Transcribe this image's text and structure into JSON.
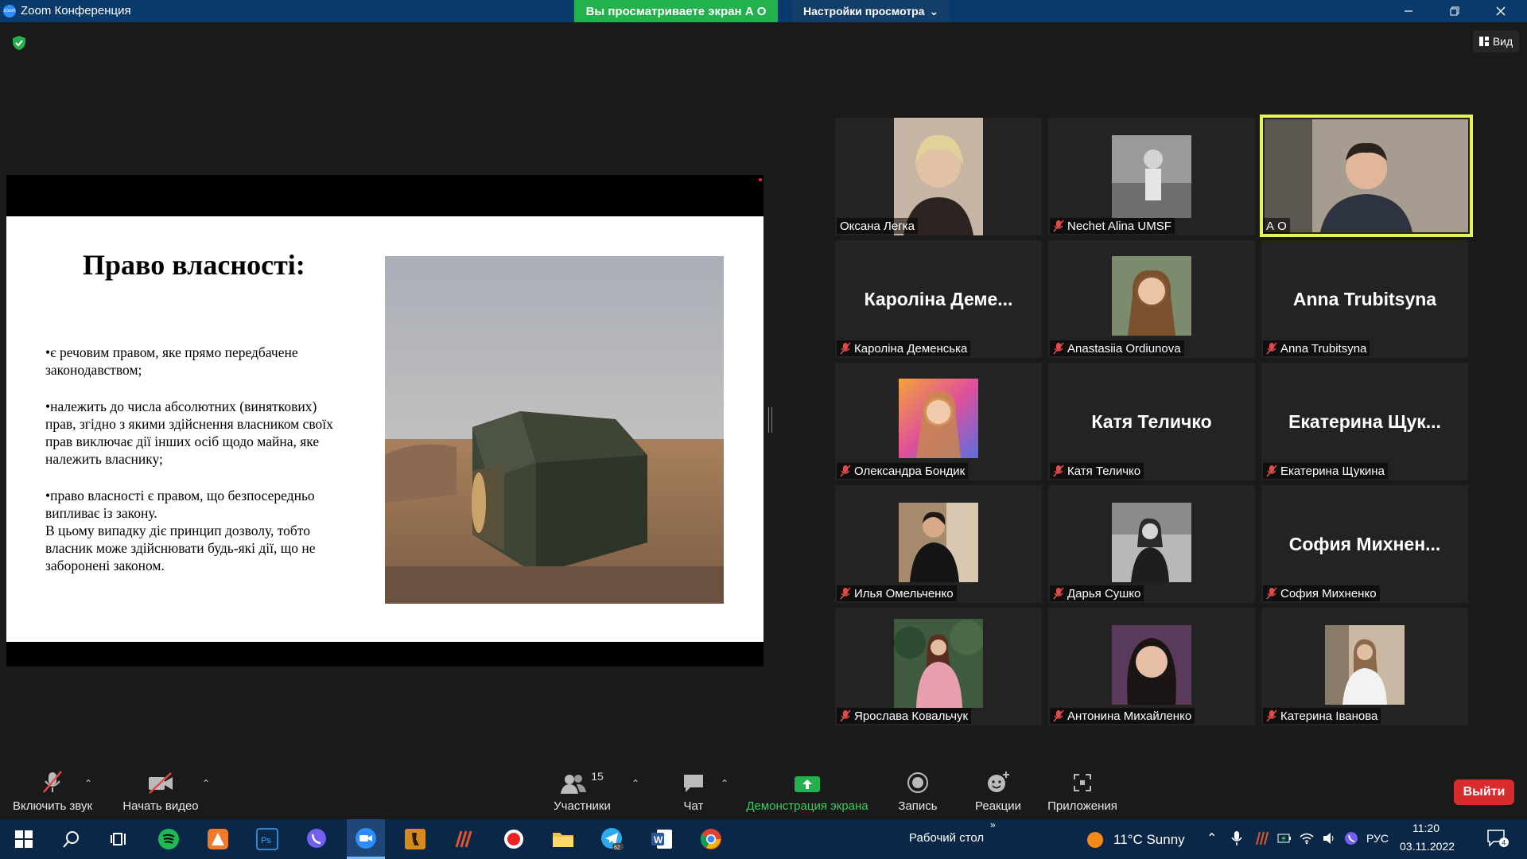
{
  "window": {
    "title": "Zoom Конференция",
    "app_icon_text": "zoom"
  },
  "banner": {
    "sharing_text": "Вы просматриваете экран А О",
    "view_settings": "Настройки просмотра"
  },
  "view_button": "Вид",
  "slide": {
    "title": "Право власності:",
    "paragraphs": [
      "•є речовим правом, яке прямо передбачене законодавством;",
      "•належить до числа абсолютних (виняткових) прав, згідно з якими здійснення власником своїх прав виключає дії інших осіб щодо майна, яке належить власнику;",
      "•право власності є правом, що безпосередньо випливає із закону.",
      "В цьому випадку діє принцип дозволу, тобто власник може здійснювати будь-які дії, що не заборонені законом."
    ]
  },
  "participants": [
    {
      "name": "Оксана Легка",
      "muted": false,
      "video": true,
      "photo": "woman-blonde"
    },
    {
      "name": "Nechet Alina UMSF",
      "muted": true,
      "video": true,
      "photo": "woman-field-bw"
    },
    {
      "name": "А О",
      "muted": false,
      "video": true,
      "photo": "man-speaker",
      "active": true
    },
    {
      "name": "Кароліна Деменська",
      "display": "Кароліна Деме...",
      "muted": true,
      "video": false
    },
    {
      "name": "Anastasiia Ordiunova",
      "muted": true,
      "video": true,
      "photo": "woman-brown-hair"
    },
    {
      "name": "Anna Trubitsyna",
      "display": "Anna Trubitsyna",
      "muted": true,
      "video": false
    },
    {
      "name": "Олександра Бондик",
      "muted": true,
      "video": true,
      "photo": "woman-colorful"
    },
    {
      "name": "Катя Теличко",
      "display": "Катя Теличко",
      "muted": true,
      "video": false
    },
    {
      "name": "Екатерина Щукина",
      "display": "Екатерина Щук...",
      "muted": true,
      "video": false
    },
    {
      "name": "Илья Омельченко",
      "muted": true,
      "video": true,
      "photo": "man-mirror"
    },
    {
      "name": "Дарья Сушко",
      "muted": true,
      "video": true,
      "photo": "woman-bw"
    },
    {
      "name": "София Михненко",
      "display": "София Михнен...",
      "muted": true,
      "video": false
    },
    {
      "name": "Ярослава Ковальчук",
      "muted": true,
      "video": true,
      "photo": "woman-pink-coat"
    },
    {
      "name": "Антонина Михайленко",
      "muted": true,
      "video": true,
      "photo": "woman-dark-hair"
    },
    {
      "name": "Катерина Іванова",
      "muted": true,
      "video": true,
      "photo": "woman-mirror"
    }
  ],
  "toolbar": {
    "unmute": "Включить звук",
    "start_video": "Начать видео",
    "participants": "Участники",
    "participants_count": "15",
    "chat": "Чат",
    "share_screen": "Демонстрация экрана",
    "record": "Запись",
    "reactions": "Реакции",
    "apps": "Приложения",
    "leave": "Выйти"
  },
  "taskbar": {
    "desktop_label": "Рабочий стол",
    "weather": "11°C  Sunny",
    "lang": "РУС",
    "time": "11:20",
    "date": "03.11.2022",
    "telegram_badge": "62",
    "notif_count": "4"
  },
  "colors": {
    "accent_green": "#22b14c",
    "active_speaker": "#e6f25c",
    "leave_red": "#d82c2c",
    "taskbar": "#0b2747"
  }
}
